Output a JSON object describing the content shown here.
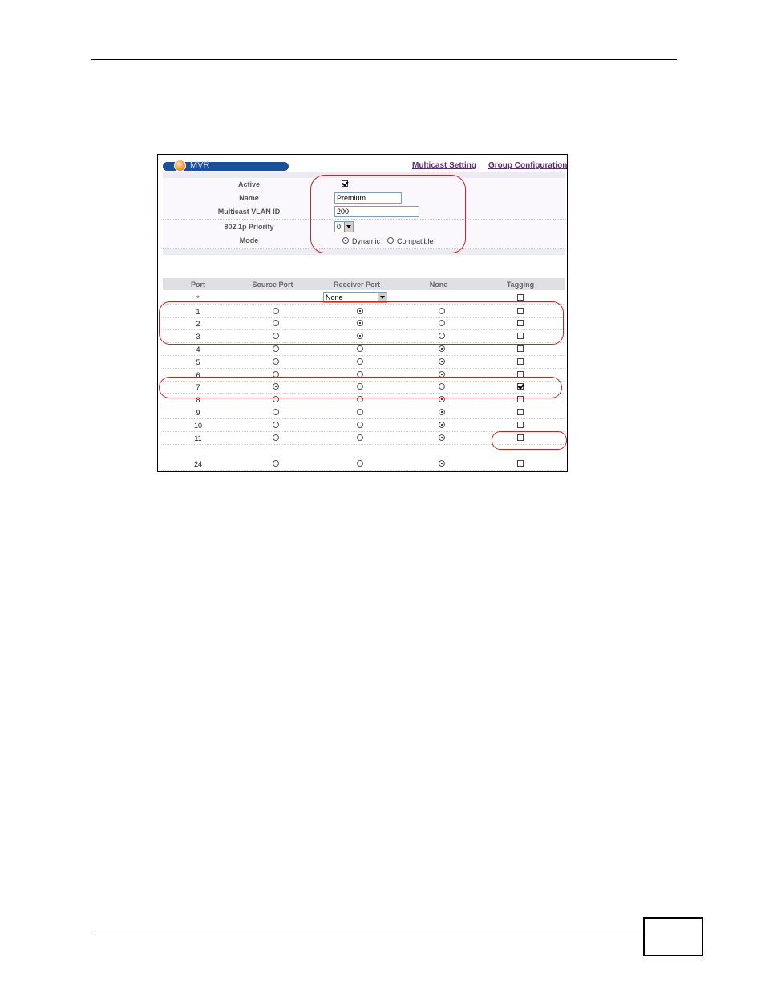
{
  "header_links": {
    "multicast_setting": "Multicast Setting",
    "group_configuration": "Group Configuration"
  },
  "title": "MVR",
  "config": {
    "active": {
      "label": "Active",
      "checked": true
    },
    "name": {
      "label": "Name",
      "value": "Premium"
    },
    "vlan": {
      "label": "Multicast VLAN ID",
      "value": "200"
    },
    "priority": {
      "label": "802.1p Priority",
      "value": "0"
    },
    "mode": {
      "label": "Mode",
      "options": [
        "Dynamic",
        "Compatible"
      ],
      "selected": "Dynamic"
    }
  },
  "table": {
    "headers": [
      "Port",
      "Source Port",
      "Receiver Port",
      "None",
      "Tagging"
    ],
    "all_row": {
      "port": "*",
      "receiver_select": "None"
    },
    "rows": [
      {
        "port": "1",
        "role": "receiver",
        "tag": false
      },
      {
        "port": "2",
        "role": "receiver",
        "tag": false
      },
      {
        "port": "3",
        "role": "receiver",
        "tag": false
      },
      {
        "port": "4",
        "role": "none",
        "tag": false
      },
      {
        "port": "5",
        "role": "none",
        "tag": false
      },
      {
        "port": "6",
        "role": "none",
        "tag": false
      },
      {
        "port": "7",
        "role": "source",
        "tag": true
      },
      {
        "port": "8",
        "role": "none",
        "tag": false
      },
      {
        "port": "9",
        "role": "none",
        "tag": false
      },
      {
        "port": "10",
        "role": "none",
        "tag": false
      },
      {
        "port": "11",
        "role": "none",
        "tag": false
      },
      {
        "port": "24",
        "role": "none",
        "tag": false
      }
    ]
  },
  "colors": {
    "annotation": "#d02020",
    "title_bar": "#1e4f9a",
    "link": "#5a2a6a"
  }
}
